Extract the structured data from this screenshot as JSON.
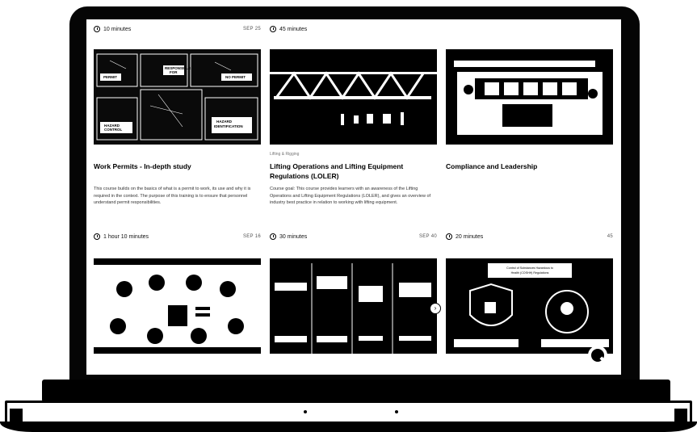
{
  "cards": [
    {
      "duration": "10 minutes",
      "badge": "SEP 25",
      "category": "",
      "title": "",
      "description": ""
    },
    {
      "duration": "45 minutes",
      "badge": "",
      "category": "",
      "title": "",
      "description": ""
    },
    {
      "duration": "",
      "badge": "",
      "category": "",
      "title": "",
      "description": ""
    },
    {
      "duration": "1 hour 10 minutes",
      "badge": "SEP 16",
      "category": "",
      "title": "Work Permits - In-depth study",
      "description": "This course builds on the basics of what is a permit to work, its use and why it is required in the context. The purpose of this training is to ensure that personnel understand permit responsibilities."
    },
    {
      "duration": "30 minutes",
      "badge": "SEP 40",
      "category": "Lifting & Rigging",
      "title": "Lifting Operations and Lifting Equipment Regulations (LOLER)",
      "description": "Course goal: This course provides learners with an awareness of the Lifting Operations and Lifting Equipment Regulations (LOLER), and gives an overview of industry best practice in relation to working with lifting equipment."
    },
    {
      "duration": "20 minutes",
      "badge": "45",
      "category": "",
      "title": "Compliance and Leadership",
      "description": ""
    }
  ],
  "thumbs": {
    "permits_panels": [
      "PERMIT",
      "RESPONSIBLE\nFOR",
      "NO PERMIT",
      "HAZARD\nCONTROL",
      "HAZARD\nIDENTIFICATION"
    ],
    "coshh_heading": "Control of Substances Hazardous to Health (COSHH) Regulations"
  },
  "next_glyph": "›"
}
